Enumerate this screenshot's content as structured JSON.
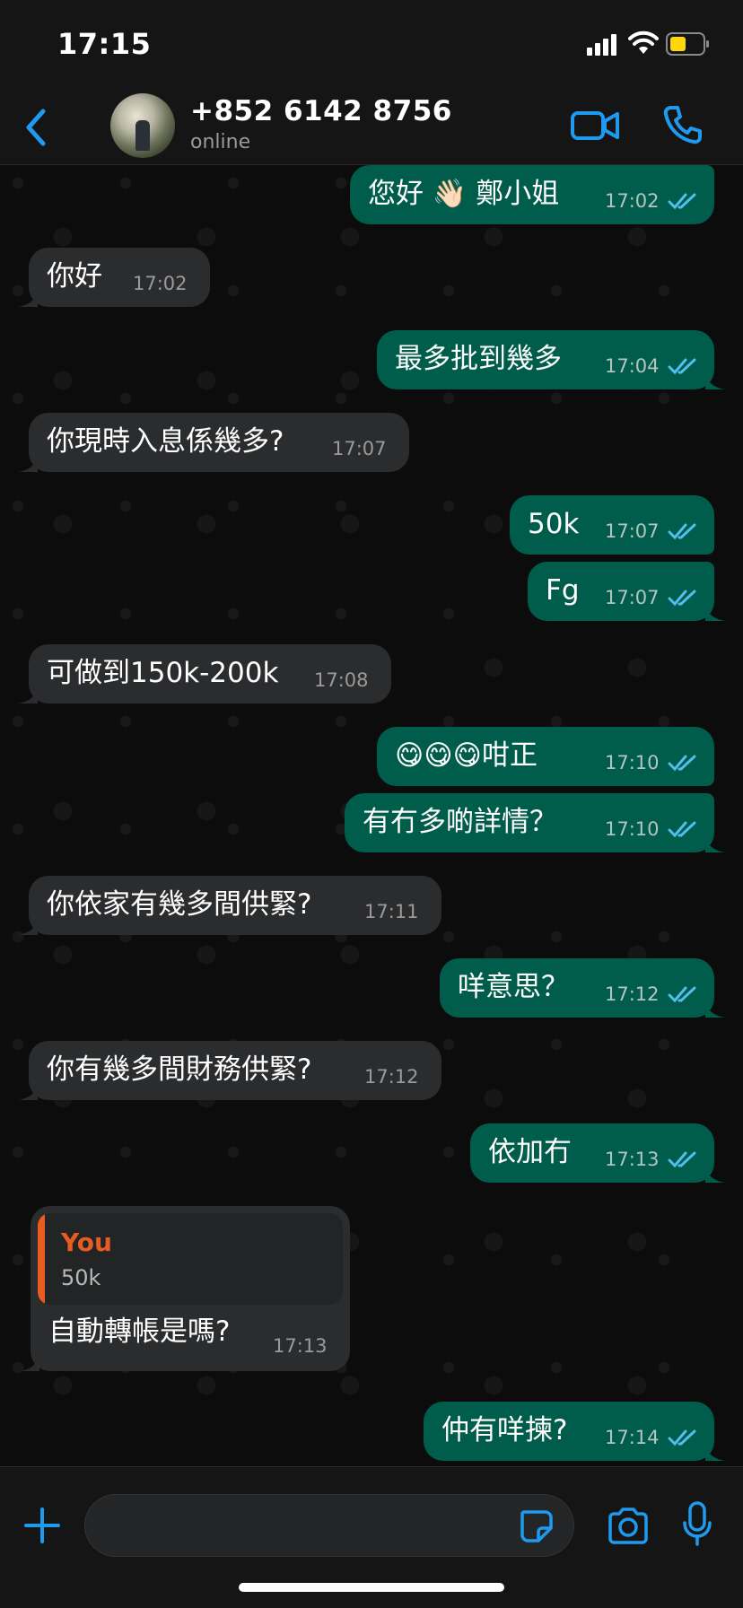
{
  "status_bar": {
    "time": "17:15",
    "icons": [
      "signal-icon",
      "wifi-icon",
      "battery-icon"
    ]
  },
  "header": {
    "contact_name": "+852 6142 8756",
    "contact_status": "online",
    "icons": [
      "back-icon",
      "video-call-icon",
      "phone-icon"
    ]
  },
  "colors": {
    "accent": "#1e9bf0",
    "outgoing_bubble": "#005c4b",
    "incoming_bubble": "#2b2c2e",
    "read_ticks": "#53bdeb",
    "quote_author": "#e85c22"
  },
  "messages": [
    {
      "direction": "out",
      "text": "您好 👋🏻 鄭小姐",
      "time": "17:02",
      "read": true
    },
    {
      "direction": "in",
      "text": "你好",
      "time": "17:02"
    },
    {
      "direction": "out",
      "text": "最多批到幾多",
      "time": "17:04",
      "read": true
    },
    {
      "direction": "in",
      "text": "你現時入息係幾多?",
      "time": "17:07"
    },
    {
      "direction": "out",
      "text": "50k",
      "time": "17:07",
      "read": true
    },
    {
      "direction": "out",
      "text": "Fg",
      "time": "17:07",
      "read": true
    },
    {
      "direction": "in",
      "text": "可做到150k-200k",
      "time": "17:08"
    },
    {
      "direction": "out",
      "text": "😋😋😋咁正",
      "time": "17:10",
      "read": true
    },
    {
      "direction": "out",
      "text": "有冇多啲詳情？",
      "time": "17:10",
      "read": true
    },
    {
      "direction": "in",
      "text": "你依家有幾多間供緊?",
      "time": "17:11"
    },
    {
      "direction": "out",
      "text": "咩意思？",
      "time": "17:12",
      "read": true
    },
    {
      "direction": "in",
      "text": "你有幾多間財務供緊?",
      "time": "17:12"
    },
    {
      "direction": "out",
      "text": "依加冇",
      "time": "17:13",
      "read": true
    },
    {
      "direction": "in",
      "reply_to": {
        "author": "You",
        "text": "50k"
      },
      "text": "自動轉帳是嗎?",
      "time": "17:13"
    },
    {
      "direction": "out",
      "text": "仲有咩揀?",
      "time": "17:14",
      "read": true
    }
  ],
  "input_bar": {
    "placeholder": "",
    "icons": [
      "plus-icon",
      "sticker-icon",
      "camera-icon",
      "microphone-icon"
    ]
  }
}
